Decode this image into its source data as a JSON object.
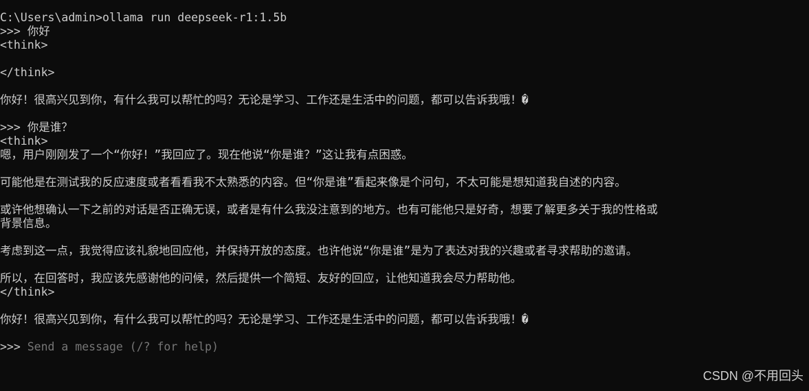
{
  "terminal": {
    "lines": [
      "C:\\Users\\admin>ollama run deepseek-r1:1.5b",
      ">>> 你好",
      "<think>",
      "",
      "</think>",
      "",
      "你好！很高兴见到你，有什么我可以帮忙的吗？无论是学习、工作还是生活中的问题，都可以告诉我哦！�",
      "",
      ">>> 你是谁？",
      "<think>",
      "嗯，用户刚刚发了一个“你好！”我回应了。现在他说“你是谁？”这让我有点困惑。",
      "",
      "可能他是在测试我的反应速度或者看看我不太熟悉的内容。但“你是谁”看起来像是个问句，不太可能是想知道我自述的内容。",
      "",
      "或许他想确认一下之前的对话是否正确无误，或者是有什么我没注意到的地方。也有可能他只是好奇，想要了解更多关于我的性格或",
      "背景信息。",
      "",
      "考虑到这一点，我觉得应该礼貌地回应他，并保持开放的态度。也许他说“你是谁”是为了表达对我的兴趣或者寻求帮助的邀请。",
      "",
      "所以，在回答时，我应该先感谢他的问候，然后提供一个简短、友好的回应，让他知道我会尽力帮助他。",
      "</think>",
      "",
      "你好！很高兴见到你，有什么我可以帮忙的吗？无论是学习、工作还是生活中的问题，都可以告诉我哦！�"
    ],
    "prompt": ">>> ",
    "input_placeholder": "Send a message (/? for help)"
  },
  "watermark": "CSDN @不用回头",
  "colors": {
    "background": "#0c0c0c",
    "text": "#cccccc",
    "placeholder": "#767676"
  }
}
